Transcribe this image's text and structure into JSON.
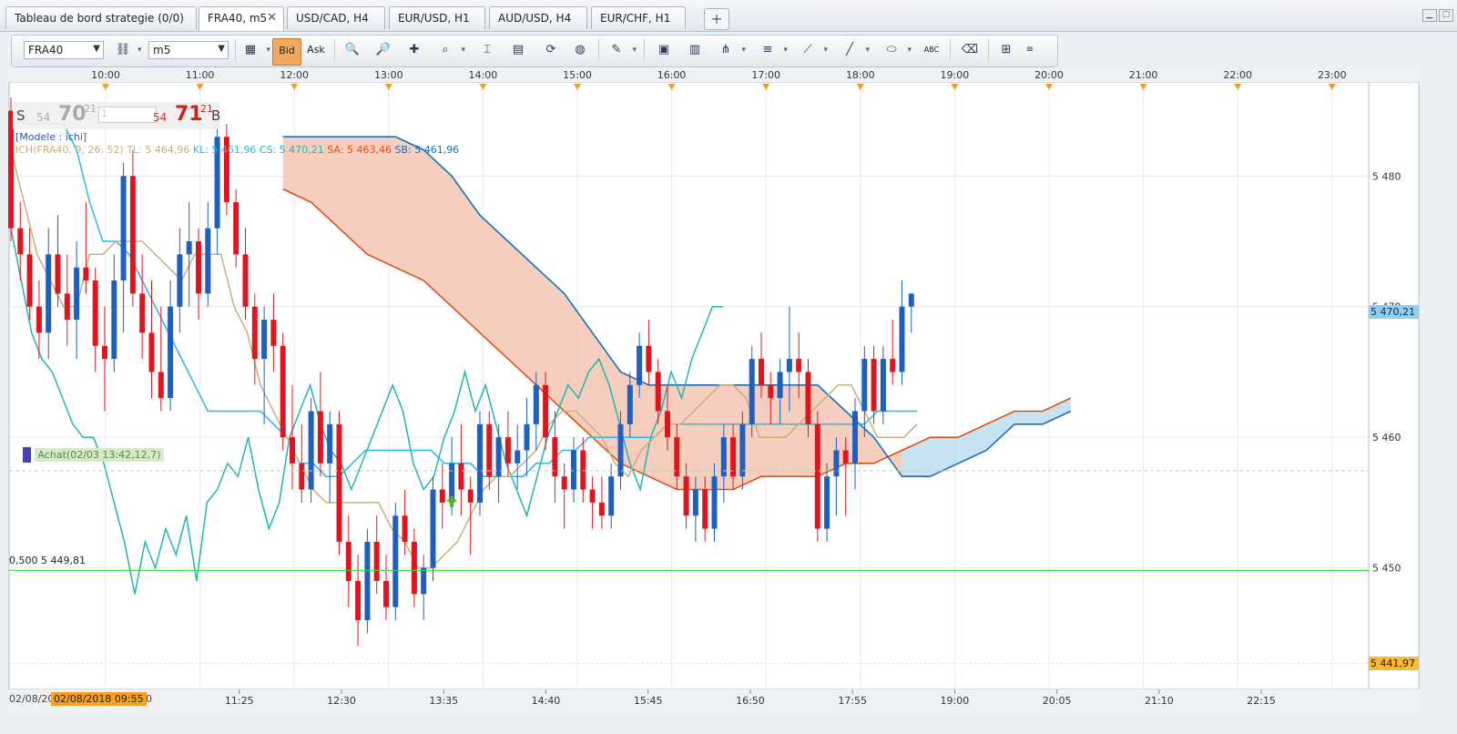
{
  "tabs": [
    {
      "label": "Tableau de bord strategie (0/0)",
      "active": false,
      "closable": false
    },
    {
      "label": "FRA40, m5",
      "active": true,
      "closable": true
    },
    {
      "label": "USD/CAD, H4",
      "active": false,
      "closable": false
    },
    {
      "label": "EUR/USD, H1",
      "active": false,
      "closable": false
    },
    {
      "label": "AUD/USD, H4",
      "active": false,
      "closable": false
    },
    {
      "label": "EUR/CHF, H1",
      "active": false,
      "closable": false
    }
  ],
  "tab_add": "+",
  "toolbar": {
    "symbol": "FRA40",
    "timeframe": "m5",
    "bid_label": "Bid",
    "ask_label": "Ask",
    "abc_label": "ABC"
  },
  "quote": {
    "sell_label": "S",
    "sell_small": "54",
    "sell_big": "70",
    "sell_sup": "21",
    "qty": "1",
    "buy_small": "54",
    "buy_big": "71",
    "buy_sup": "21",
    "buy_label": "B"
  },
  "model_label": "[Modele : ichi]",
  "ichimoku": {
    "name": "ICH(FRA40, 9, 26, 52)",
    "tl": "TL: 5 464,96",
    "kl": "KL: 5 461,96",
    "cs": "CS: 5 470,21",
    "sa": "SA: 5 463,46",
    "sb": "SB: 5 461,96"
  },
  "order_label": "Achat(02/03 13:42,12,7)",
  "hline_label": "0,500 5 449,81",
  "price_tags": {
    "current": "5 470,21",
    "low": "5 441,97"
  },
  "bottom_date_label": "02/08/2018 09:55",
  "bottom_left_partial": "02/08/20",
  "bottom_zero_partial": "0",
  "colors": {
    "bull": "#1f5fbf",
    "bear": "#e0141e",
    "tenkan": "#c4b07a",
    "kijun": "#29b6e8",
    "chikou": "#1fb5b5",
    "span_a": "#e34d12",
    "span_b": "#1470b8",
    "kumo_bear": "#f2c2ac",
    "kumo_bull": "#b9dcee",
    "level_line": "#33dd33"
  },
  "chart_data": {
    "type": "candlestick",
    "symbol": "FRA40",
    "timeframe": "m5",
    "top_time_axis": [
      "10:00",
      "11:00",
      "12:00",
      "13:00",
      "14:00",
      "15:00",
      "16:00",
      "17:00",
      "18:00",
      "19:00",
      "20:00",
      "21:00",
      "22:00",
      "23:00"
    ],
    "bottom_time_axis": [
      "11:25",
      "12:30",
      "13:35",
      "14:40",
      "15:45",
      "16:50",
      "17:55",
      "19:00",
      "20:05",
      "21:10",
      "22:15"
    ],
    "y_ticks": [
      5450,
      5460,
      5470,
      5480
    ],
    "y_tick_labels": [
      "5 450",
      "5 460",
      "5 470",
      "5 480"
    ],
    "ylim": [
      5440.7,
      5487.2
    ],
    "candles": [
      [
        5485,
        5486,
        5475,
        5476
      ],
      [
        5476,
        5478,
        5472,
        5474
      ],
      [
        5474,
        5476,
        5469,
        5470
      ],
      [
        5470,
        5472,
        5466,
        5468
      ],
      [
        5468,
        5476,
        5466,
        5474
      ],
      [
        5474,
        5477,
        5470,
        5471
      ],
      [
        5471,
        5474,
        5467,
        5469
      ],
      [
        5469,
        5475,
        5466,
        5473
      ],
      [
        5473,
        5478,
        5471,
        5472
      ],
      [
        5472,
        5473,
        5465,
        5467
      ],
      [
        5467,
        5470,
        5462,
        5466
      ],
      [
        5466,
        5474,
        5465,
        5472
      ],
      [
        5472,
        5481,
        5468,
        5480
      ],
      [
        5480,
        5482,
        5470,
        5471
      ],
      [
        5471,
        5474,
        5466,
        5468
      ],
      [
        5468,
        5472,
        5463,
        5465
      ],
      [
        5465,
        5470,
        5462,
        5463
      ],
      [
        5463,
        5472,
        5462,
        5470
      ],
      [
        5470,
        5476,
        5468,
        5474
      ],
      [
        5474,
        5478,
        5470,
        5475
      ],
      [
        5475,
        5476,
        5469,
        5471
      ],
      [
        5471,
        5478,
        5470,
        5476
      ],
      [
        5476,
        5484,
        5474,
        5483
      ],
      [
        5483,
        5484,
        5477,
        5478
      ],
      [
        5478,
        5479,
        5473,
        5474
      ],
      [
        5474,
        5476,
        5469,
        5470
      ],
      [
        5470,
        5471,
        5464,
        5466
      ],
      [
        5466,
        5470,
        5461,
        5469
      ],
      [
        5469,
        5471,
        5465,
        5467
      ],
      [
        5467,
        5468,
        5459,
        5460
      ],
      [
        5460,
        5464,
        5456,
        5458
      ],
      [
        5458,
        5461,
        5455,
        5456
      ],
      [
        5456,
        5463,
        5455,
        5462
      ],
      [
        5462,
        5465,
        5457,
        5458
      ],
      [
        5458,
        5462,
        5455,
        5461
      ],
      [
        5461,
        5462,
        5451,
        5452
      ],
      [
        5452,
        5454,
        5447,
        5449
      ],
      [
        5449,
        5451,
        5444,
        5446
      ],
      [
        5446,
        5453,
        5445,
        5452
      ],
      [
        5452,
        5454,
        5448,
        5449
      ],
      [
        5449,
        5451,
        5446,
        5447
      ],
      [
        5447,
        5455,
        5446,
        5454
      ],
      [
        5454,
        5456,
        5451,
        5452
      ],
      [
        5452,
        5453,
        5447,
        5448
      ],
      [
        5448,
        5451,
        5446,
        5450
      ],
      [
        5450,
        5457,
        5449,
        5456
      ],
      [
        5456,
        5458,
        5453,
        5455
      ],
      [
        5455,
        5460,
        5454,
        5458
      ],
      [
        5458,
        5461,
        5454,
        5456
      ],
      [
        5456,
        5457,
        5451,
        5455
      ],
      [
        5455,
        5462,
        5454,
        5461
      ],
      [
        5461,
        5462,
        5456,
        5457
      ],
      [
        5457,
        5461,
        5455,
        5460
      ],
      [
        5460,
        5462,
        5457,
        5458
      ],
      [
        5458,
        5461,
        5456,
        5459
      ],
      [
        5459,
        5463,
        5457,
        5461
      ],
      [
        5461,
        5465,
        5459,
        5464
      ],
      [
        5464,
        5465,
        5459,
        5460
      ],
      [
        5460,
        5462,
        5455,
        5457
      ],
      [
        5457,
        5458,
        5453,
        5456
      ],
      [
        5456,
        5460,
        5455,
        5459
      ],
      [
        5459,
        5460,
        5455,
        5456
      ],
      [
        5456,
        5457,
        5453,
        5455
      ],
      [
        5455,
        5457,
        5453,
        5454
      ],
      [
        5454,
        5458,
        5453,
        5457
      ],
      [
        5457,
        5462,
        5456,
        5461
      ],
      [
        5461,
        5465,
        5460,
        5464
      ],
      [
        5464,
        5468,
        5463,
        5467
      ],
      [
        5467,
        5469,
        5464,
        5465
      ],
      [
        5465,
        5466,
        5461,
        5462
      ],
      [
        5462,
        5464,
        5459,
        5460
      ],
      [
        5460,
        5461,
        5456,
        5457
      ],
      [
        5457,
        5458,
        5453,
        5454
      ],
      [
        5454,
        5457,
        5452,
        5456
      ],
      [
        5456,
        5457,
        5452,
        5453
      ],
      [
        5453,
        5458,
        5452,
        5457
      ],
      [
        5457,
        5461,
        5455,
        5460
      ],
      [
        5460,
        5461,
        5456,
        5457
      ],
      [
        5457,
        5462,
        5456,
        5461
      ],
      [
        5461,
        5467,
        5460,
        5466
      ],
      [
        5466,
        5468,
        5463,
        5464
      ],
      [
        5464,
        5465,
        5461,
        5463
      ],
      [
        5463,
        5466,
        5461,
        5465
      ],
      [
        5465,
        5470,
        5462,
        5466
      ],
      [
        5466,
        5468,
        5463,
        5465
      ],
      [
        5465,
        5466,
        5460,
        5461
      ],
      [
        5461,
        5462,
        5452,
        5453
      ],
      [
        5453,
        5458,
        5452,
        5457
      ],
      [
        5457,
        5460,
        5454,
        5459
      ],
      [
        5459,
        5460,
        5454,
        5458
      ],
      [
        5458,
        5463,
        5456,
        5462
      ],
      [
        5462,
        5467,
        5460,
        5466
      ],
      [
        5466,
        5467,
        5461,
        5462
      ],
      [
        5462,
        5467,
        5461,
        5466
      ],
      [
        5466,
        5469,
        5464,
        5465
      ],
      [
        5465,
        5472,
        5464,
        5470
      ],
      [
        5470,
        5471,
        5468,
        5471
      ]
    ],
    "indicator": "Ichimoku(9, 26, 52)",
    "tenkan": [
      5482,
      5478,
      5474,
      5472,
      5470,
      5470,
      5474,
      5474,
      5475,
      5475,
      5475,
      5474,
      5473,
      5472,
      5474,
      5474,
      5474,
      5470,
      5468,
      5464,
      5462,
      5460,
      5458,
      5456,
      5455,
      5455,
      5455,
      5455,
      5455,
      5453,
      5452,
      5450,
      5450,
      5451,
      5452,
      5454,
      5456,
      5457,
      5457,
      5458,
      5459,
      5461,
      5462,
      5462,
      5461,
      5460,
      5458,
      5457,
      5459,
      5460,
      5461,
      5461,
      5462,
      5463,
      5464,
      5464,
      5463,
      5460,
      5460,
      5460,
      5461,
      5462,
      5463,
      5464,
      5464,
      5462,
      5460,
      5460,
      5460,
      5461
    ],
    "kijun": [
      5485,
      5484,
      5484,
      5484,
      5484,
      5482,
      5478,
      5475,
      5475,
      5474,
      5472,
      5470,
      5468,
      5466,
      5464,
      5462,
      5462,
      5462,
      5462,
      5462,
      5461,
      5460,
      5458,
      5458,
      5457,
      5457,
      5458,
      5459,
      5459,
      5459,
      5459,
      5459,
      5459,
      5458,
      5458,
      5458,
      5457,
      5457,
      5457,
      5457,
      5458,
      5458,
      5459,
      5459,
      5460,
      5460,
      5460,
      5460,
      5460,
      5460,
      5461,
      5461,
      5461,
      5461,
      5461,
      5461,
      5461,
      5461,
      5461,
      5461,
      5461,
      5461,
      5461,
      5461,
      5461,
      5461,
      5462,
      5462,
      5462,
      5462
    ],
    "chikou": [
      5476,
      5472,
      5468,
      5466,
      5465,
      5463,
      5461,
      5460,
      5460,
      5458,
      5455,
      5452,
      5448,
      5452,
      5450,
      5453,
      5451,
      5454,
      5449,
      5455,
      5456,
      5458,
      5457,
      5460,
      5456,
      5453,
      5455,
      5460,
      5462,
      5464,
      5461,
      5459,
      5458,
      5456,
      5458,
      5460,
      5462,
      5464,
      5462,
      5458,
      5456,
      5457,
      5460,
      5462,
      5465,
      5462,
      5464,
      5461,
      5458,
      5456,
      5454,
      5457,
      5460,
      5462,
      5464,
      5463,
      5465,
      5466,
      5464,
      5461,
      5458,
      5456,
      5460,
      5462,
      5465,
      5463,
      5466,
      5468,
      5470,
      5470
    ],
    "senkou_a": [
      5479,
      5478,
      5476,
      5474,
      5473,
      5472,
      5470,
      5468,
      5466,
      5464,
      5462,
      5460,
      5458,
      5457,
      5456,
      5456,
      5456,
      5457,
      5457,
      5457,
      5458,
      5458,
      5459,
      5460,
      5460,
      5461,
      5462,
      5462,
      5463
    ],
    "senkou_b": [
      5483,
      5483,
      5483,
      5483,
      5483,
      5482,
      5480,
      5477,
      5475,
      5473,
      5471,
      5468,
      5465,
      5464,
      5464,
      5464,
      5464,
      5464,
      5464,
      5464,
      5462,
      5460,
      5457,
      5457,
      5458,
      5459,
      5461,
      5461,
      5462
    ],
    "horizontal_lines": [
      {
        "label": "0,500 5 449,81",
        "value": 5449.81
      }
    ],
    "order_marker": {
      "label": "Achat(02/03 13:42,12,7)"
    },
    "price_tags": [
      5470.21,
      5441.97
    ]
  }
}
